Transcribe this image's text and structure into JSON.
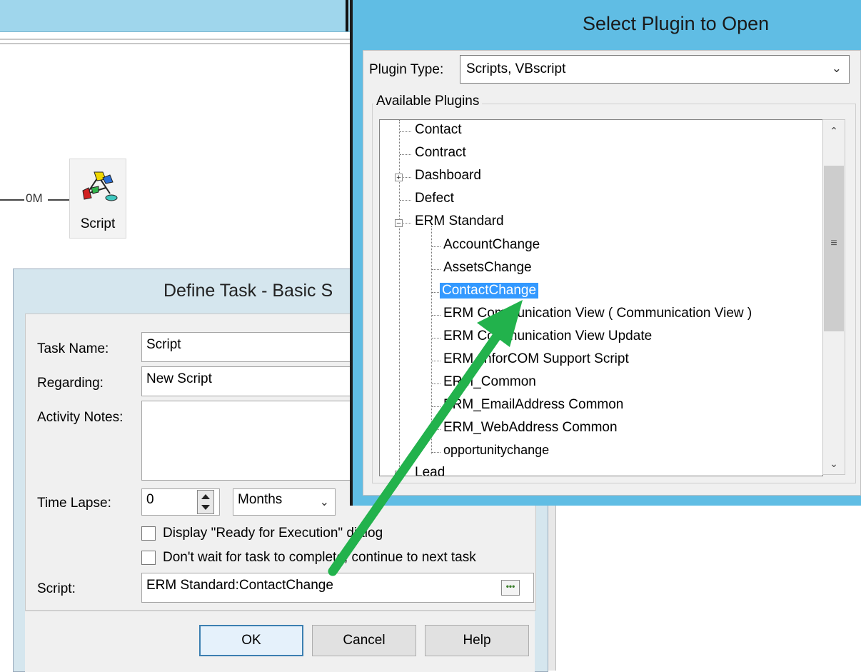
{
  "canvas": {
    "flow_label": "0M",
    "node_label": "Script"
  },
  "define_task": {
    "title": "Define Task - Basic S",
    "task_name_label": "Task Name:",
    "task_name_value": "Script",
    "regarding_label": "Regarding:",
    "regarding_value": "New Script",
    "notes_label": "Activity Notes:",
    "time_lapse_label": "Time Lapse:",
    "time_lapse_value": "0",
    "time_unit": "Months",
    "check_display": "Display \"Ready for Execution\" dialog",
    "check_nowait": "Don't wait for task to complete, continue to next task",
    "script_label": "Script:",
    "script_value": "ERM Standard:ContactChange",
    "ok": "OK",
    "cancel": "Cancel",
    "help": "Help"
  },
  "select_plugin": {
    "title": "Select Plugin to Open",
    "type_label": "Plugin Type:",
    "type_value": "Scripts, VBscript",
    "group_label": "Available Plugins",
    "items": {
      "contact": "Contact",
      "contract": "Contract",
      "dashboard": "Dashboard",
      "defect": "Defect",
      "erm_standard": "ERM Standard",
      "account_change": "AccountChange",
      "assets_change": "AssetsChange",
      "contact_change": "ContactChange",
      "erm_comm_view": "ERM Communication View   ( Communication View )",
      "erm_comm_view_update": "ERM Communication View Update",
      "erm_infor_support": "ERM_inforCOM Support Script",
      "erm_common": "ERM_Common",
      "erm_email_common": "ERM_EmailAddress Common",
      "erm_web_common": "ERM_WebAddress Common",
      "opportunity_change": "opportunitychange",
      "lead": "Lead"
    }
  },
  "colors": {
    "dialog_title_bar": "#60bde4",
    "selection": "#3399ff",
    "arrow": "#22b24c"
  },
  "icons": {
    "node": "script-workflow-icon",
    "dots": "ellipsis-icon",
    "arrow": "green-pointer-arrow"
  }
}
